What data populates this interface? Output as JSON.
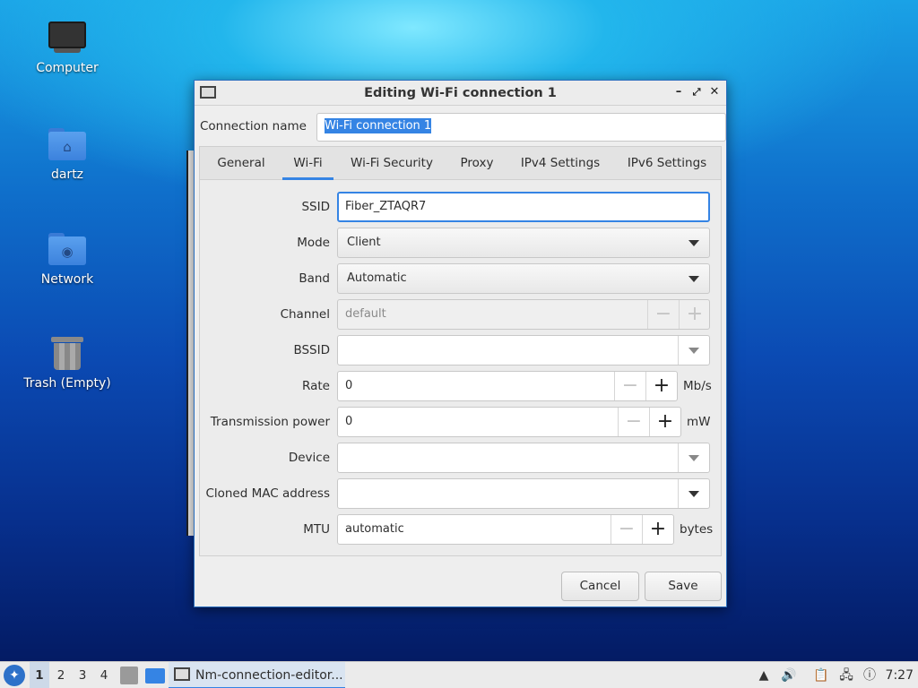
{
  "desktop": {
    "icons": [
      {
        "label": "Computer"
      },
      {
        "label": "dartz"
      },
      {
        "label": "Network"
      },
      {
        "label": "Trash (Empty)"
      }
    ]
  },
  "dialog": {
    "title": "Editing Wi-Fi connection 1",
    "connection_name_label": "Connection name",
    "connection_name_value": "Wi-Fi connection 1",
    "tabs": [
      {
        "label": "General"
      },
      {
        "label": "Wi-Fi",
        "active": true
      },
      {
        "label": "Wi-Fi Security"
      },
      {
        "label": "Proxy"
      },
      {
        "label": "IPv4 Settings"
      },
      {
        "label": "IPv6 Settings"
      }
    ],
    "fields": {
      "ssid": {
        "label": "SSID",
        "value": "Fiber_ZTAQR7"
      },
      "mode": {
        "label": "Mode",
        "value": "Client"
      },
      "band": {
        "label": "Band",
        "value": "Automatic"
      },
      "channel": {
        "label": "Channel",
        "value": "default"
      },
      "bssid": {
        "label": "BSSID",
        "value": ""
      },
      "rate": {
        "label": "Rate",
        "value": "0",
        "unit": "Mb/s"
      },
      "tx_power": {
        "label": "Transmission power",
        "value": "0",
        "unit": "mW"
      },
      "device": {
        "label": "Device",
        "value": ""
      },
      "cloned_mac": {
        "label": "Cloned MAC address",
        "value": ""
      },
      "mtu": {
        "label": "MTU",
        "value": "automatic",
        "unit": "bytes"
      }
    },
    "buttons": {
      "cancel": "Cancel",
      "save": "Save"
    }
  },
  "taskbar": {
    "workspaces": [
      "1",
      "2",
      "3",
      "4"
    ],
    "active_workspace": "1",
    "task_label": "Nm-connection-editor...",
    "clock": "7:27"
  }
}
